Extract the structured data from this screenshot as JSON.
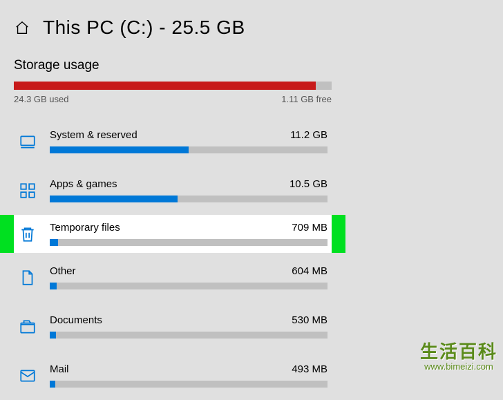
{
  "header": {
    "title": "This PC (C:) - 25.5 GB"
  },
  "section_title": "Storage usage",
  "overall": {
    "used_label": "24.3 GB used",
    "free_label": "1.11 GB free",
    "fill_percent": 95
  },
  "categories": [
    {
      "icon": "system",
      "name": "System & reserved",
      "size": "11.2 GB",
      "fill_percent": 50,
      "highlighted": false
    },
    {
      "icon": "apps",
      "name": "Apps & games",
      "size": "10.5 GB",
      "fill_percent": 46,
      "highlighted": false
    },
    {
      "icon": "trash",
      "name": "Temporary files",
      "size": "709 MB",
      "fill_percent": 3,
      "highlighted": true
    },
    {
      "icon": "other",
      "name": "Other",
      "size": "604 MB",
      "fill_percent": 2.5,
      "highlighted": false
    },
    {
      "icon": "documents",
      "name": "Documents",
      "size": "530 MB",
      "fill_percent": 2.3,
      "highlighted": false
    },
    {
      "icon": "mail",
      "name": "Mail",
      "size": "493 MB",
      "fill_percent": 2.1,
      "highlighted": false
    }
  ],
  "watermark": {
    "text_cn": "生活百科",
    "url": "www.bimeizi.com"
  },
  "colors": {
    "accent_blue": "#0078d7",
    "used_red": "#c71919",
    "highlight_green": "#00e020"
  }
}
